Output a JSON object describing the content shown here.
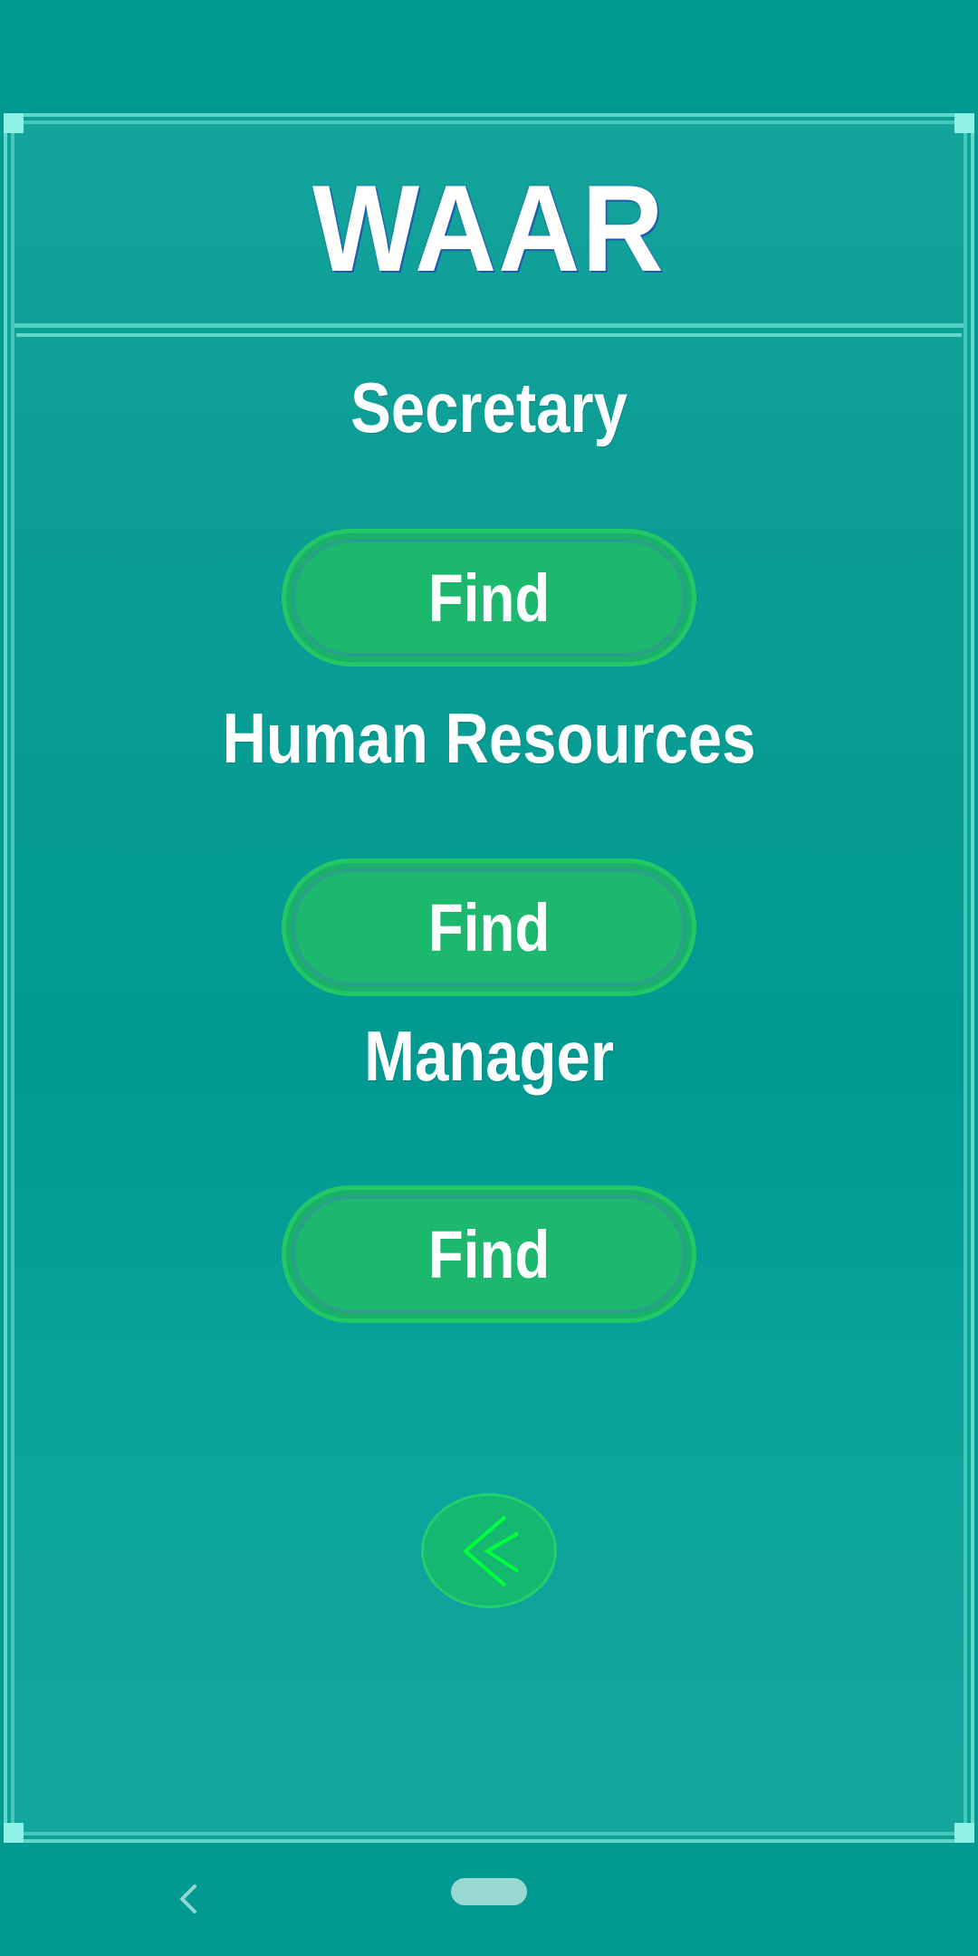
{
  "app": {
    "title": "WAAR"
  },
  "sections": [
    {
      "label": "Secretary",
      "button_label": "Find"
    },
    {
      "label": "Human Resources",
      "button_label": "Find"
    },
    {
      "label": "Manager",
      "button_label": "Find"
    }
  ],
  "back_button": {
    "icon": "double-chevron-left-icon"
  },
  "nav_bar": {
    "back_icon": "chevron-left-icon",
    "home_icon": "home-pill-icon"
  },
  "colors": {
    "background": "#009a93",
    "button_fill": "#1bb86e",
    "button_border": "#21c865",
    "frame_border": "#5fd6c8",
    "accent_chevron": "#00ff3c"
  }
}
